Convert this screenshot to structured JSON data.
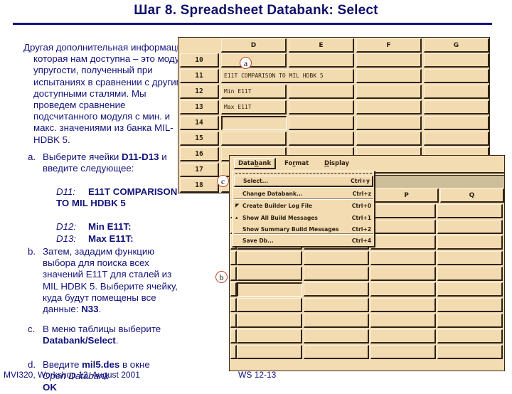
{
  "slide": {
    "title": "Шаг 8.  Spreadsheet Databank:  Select",
    "intro": "Другая дополнительная информация, которая нам доступна – это модуль упругости, полученный при испытаниях в сравнении с другими доступными сталями. Мы проведем сравнение подсчитанного модуля с мин. и макс. значениями из банка MIL-HDBK 5.",
    "steps": {
      "a": {
        "marker": "a.",
        "text_pre": "Выберите ячейки ",
        "text_bold": "D11-D13",
        "text_post": " и введите следующее:",
        "entries": [
          {
            "key": "D11:",
            "value": "E11T COMPARISON TO MIL HDBK 5"
          },
          {
            "key": "D12:",
            "value": "Min E11T:"
          },
          {
            "key": "D13:",
            "value": "Max E11T:"
          }
        ]
      },
      "b": {
        "marker": "b.",
        "text_pre": "Затем, зададим функцию выбора для поиска всех значений E11T для сталей из MIL HDBK 5. Выберите ячейку, куда будут помещены все данные: ",
        "text_bold": "N33",
        "text_post": "."
      },
      "c": {
        "marker": "c.",
        "text_pre": "В меню таблицы выберите ",
        "text_bold": "Databank/Select",
        "text_post": "."
      },
      "d": {
        "marker": "d.",
        "text_pre": "Введите ",
        "text_bold": "mil5.des",
        "text_post": " в окне",
        "line2_italic": "Open Databank",
        "line3_bold": "OK"
      }
    },
    "footer_left": "MVI320, Workshop 12, August 2001",
    "footer_right": "WS 12-13"
  },
  "spreadsheet_top": {
    "columns": [
      "D",
      "E",
      "F",
      "G"
    ],
    "rows": [
      "10",
      "11",
      "12",
      "13",
      "14",
      "15",
      "16",
      "17",
      "18"
    ],
    "cells": {
      "D11": "E11T COMPARISON TO MIL HDBK 5",
      "D12": "Min E11T",
      "D13": "Max E11T"
    }
  },
  "callouts": {
    "a": "a",
    "b": "b",
    "c": "c"
  },
  "spreadsheet_bottom": {
    "columns": [
      "P",
      "Q"
    ],
    "menubar": [
      {
        "label": "Databank",
        "underline_index": 4
      },
      {
        "label": "Format",
        "underline_index": 2
      },
      {
        "label": "Display",
        "underline_index": 0
      }
    ],
    "databank_menu": [
      {
        "label": "Select...",
        "shortcut": "Ctrl+y",
        "indicator": "",
        "highlighted": true
      },
      {
        "label": "Change Databank...",
        "shortcut": "Ctrl+z",
        "indicator": ""
      },
      {
        "label": "Create Builder Log File",
        "shortcut": "Ctrl+0",
        "indicator": "checkbox-on"
      },
      {
        "label": "Show All Build Messages",
        "shortcut": "Ctrl+1",
        "indicator": "radio-on"
      },
      {
        "label": "Show Summary Build Messages",
        "shortcut": "Ctrl+2",
        "indicator": ""
      },
      {
        "label": "Save Db...",
        "shortcut": "Ctrl+4",
        "indicator": ""
      }
    ]
  },
  "colors": {
    "title": "#10106a",
    "body_text": "#12127a",
    "cell_bg": "#f2dbb0",
    "cell_shadow": "#2e2216",
    "callout_ring": "#c0452a",
    "selection_bar": "#cdbd98"
  }
}
